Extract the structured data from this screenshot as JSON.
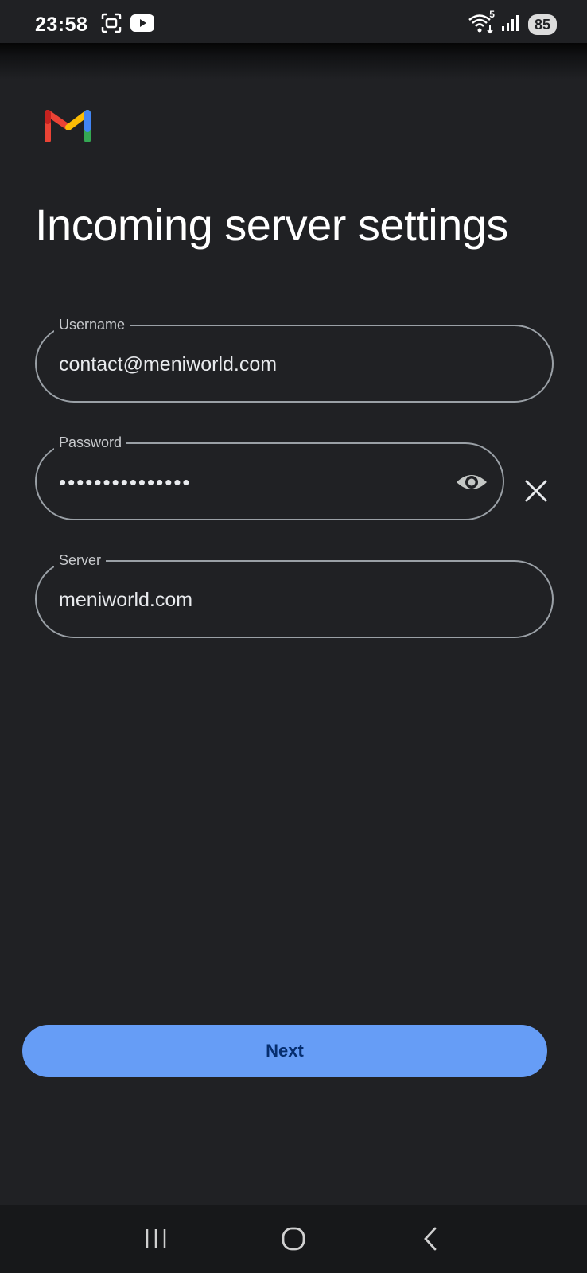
{
  "status_bar": {
    "time": "23:58",
    "left_icons": [
      "screen-record-icon",
      "youtube-icon"
    ],
    "right_icons": [
      "wifi-icon",
      "signal-icon"
    ],
    "wifi_badge": "5",
    "battery": "85"
  },
  "app": {
    "logo": "gmail-logo",
    "title": "Incoming server settings"
  },
  "form": {
    "username": {
      "label": "Username",
      "value": "contact@meniworld.com"
    },
    "password": {
      "label": "Password",
      "value": "•••••••••••••••",
      "toggle_icon": "eye-icon",
      "clear_icon": "close-icon"
    },
    "server": {
      "label": "Server",
      "value": "meniworld.com"
    }
  },
  "actions": {
    "next_label": "Next"
  },
  "nav_bar": {
    "buttons": [
      "recent-apps-icon",
      "home-icon",
      "back-icon"
    ]
  },
  "colors": {
    "background": "#202124",
    "accent": "#669df6",
    "field_border": "#9aa0a6"
  }
}
